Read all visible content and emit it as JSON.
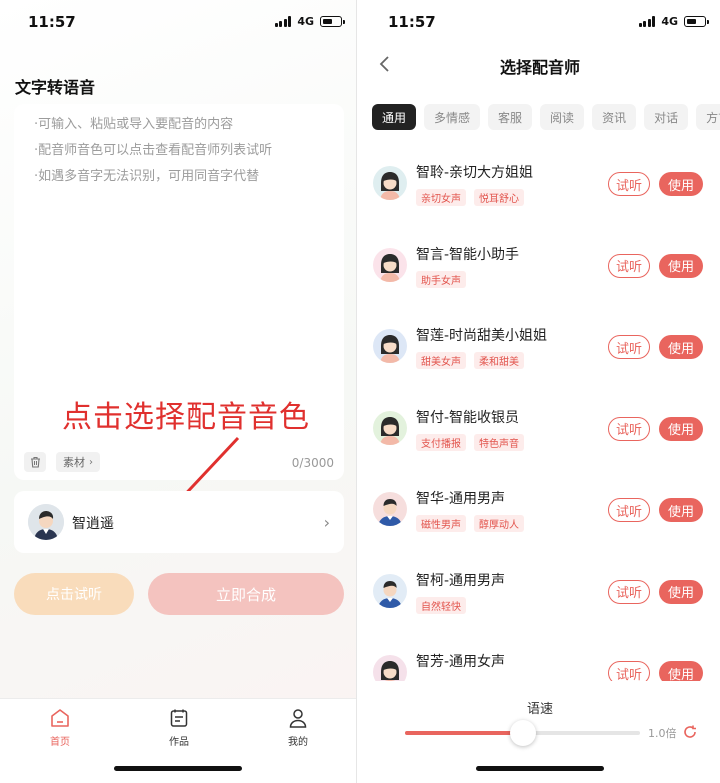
{
  "left": {
    "status": {
      "time": "11:57",
      "network": "4G"
    },
    "title": "文字转语音",
    "hints": [
      "·可输入、粘贴或导入要配音的内容",
      "·配音师音色可以点击查看配音师列表试听",
      "·如遇多音字无法识别，可用同音字代替"
    ],
    "material_label": "素材",
    "char_count": "0/3000",
    "annotation": "点击选择配音音色",
    "selected_voice": "智逍遥",
    "listen_label": "点击试听",
    "synth_label": "立即合成",
    "tabs": [
      {
        "label": "首页",
        "icon": "home-icon",
        "active": true
      },
      {
        "label": "作品",
        "icon": "works-icon",
        "active": false
      },
      {
        "label": "我的",
        "icon": "profile-icon",
        "active": false
      }
    ]
  },
  "right": {
    "status": {
      "time": "11:57",
      "network": "4G"
    },
    "title": "选择配音师",
    "categories": [
      "通用",
      "多情感",
      "客服",
      "阅读",
      "资讯",
      "对话",
      "方言"
    ],
    "active_category": "通用",
    "try_label": "试听",
    "use_label": "使用",
    "voices": [
      {
        "name": "智聆-亲切大方姐姐",
        "tags": [
          "亲切女声",
          "悦耳舒心"
        ],
        "avatar": "female-avatar"
      },
      {
        "name": "智言-智能小助手",
        "tags": [
          "助手女声"
        ],
        "avatar": "female-avatar"
      },
      {
        "name": "智莲-时尚甜美小姐姐",
        "tags": [
          "甜美女声",
          "柔和甜美"
        ],
        "avatar": "female-avatar"
      },
      {
        "name": "智付-智能收银员",
        "tags": [
          "支付播报",
          "特色声音"
        ],
        "avatar": "female-avatar"
      },
      {
        "name": "智华-通用男声",
        "tags": [
          "磁性男声",
          "醇厚动人"
        ],
        "avatar": "male-avatar"
      },
      {
        "name": "智柯-通用男声",
        "tags": [
          "自然轻快"
        ],
        "avatar": "male-avatar"
      },
      {
        "name": "智芳-通用女声",
        "tags": [],
        "avatar": "female-avatar"
      }
    ],
    "speed": {
      "label": "语速",
      "value_text": "1.0倍",
      "level": 0.5
    }
  },
  "colors": {
    "accent": "#e9655e",
    "annotation": "#e0302e",
    "listen_btn": "#f9dcbb",
    "synth_btn": "#f4c3bf"
  }
}
